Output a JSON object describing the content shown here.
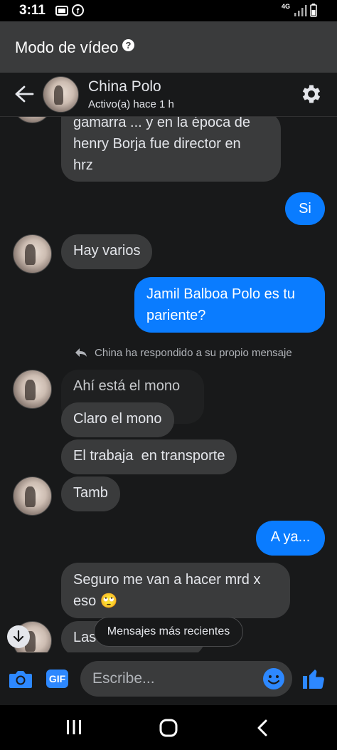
{
  "status_bar": {
    "time": "3:11",
    "network": "4G"
  },
  "video_mode": {
    "label": "Modo de vídeo",
    "help_icon": "?"
  },
  "header": {
    "contact_name": "China Polo",
    "contact_status": "Activo(a) hace 1 h"
  },
  "messages": [
    {
      "dir": "in",
      "text": "gamarra ... y en la época de\nhenry Borja fue director en\nhrz"
    },
    {
      "dir": "out",
      "text": "Si"
    },
    {
      "dir": "in",
      "text": "Hay varios"
    },
    {
      "dir": "out",
      "text": "Jamil Balboa Polo es tu\npariente?"
    },
    {
      "dir": "note",
      "text": "China ha respondido a su propio mensaje"
    },
    {
      "dir": "in",
      "text": "Ahí está el mono"
    },
    {
      "dir": "in",
      "text": "Claro el mono"
    },
    {
      "dir": "in",
      "text": "El trabaja  en transporte"
    },
    {
      "dir": "in",
      "text": "Tamb"
    },
    {
      "dir": "out",
      "text": "A ya..."
    },
    {
      "dir": "in",
      "text": "Seguro me van a hacer mrd x\neso 🙄"
    },
    {
      "dir": "in",
      "text": "Las"
    }
  ],
  "toast": {
    "label": "Mensajes más recientes"
  },
  "composer": {
    "placeholder": "Escribe...",
    "gif_label": "GIF"
  },
  "colors": {
    "outgoing": "#0a7cff",
    "incoming": "#3a3b3c",
    "background": "#18191a",
    "accent": "#2d88ff"
  }
}
